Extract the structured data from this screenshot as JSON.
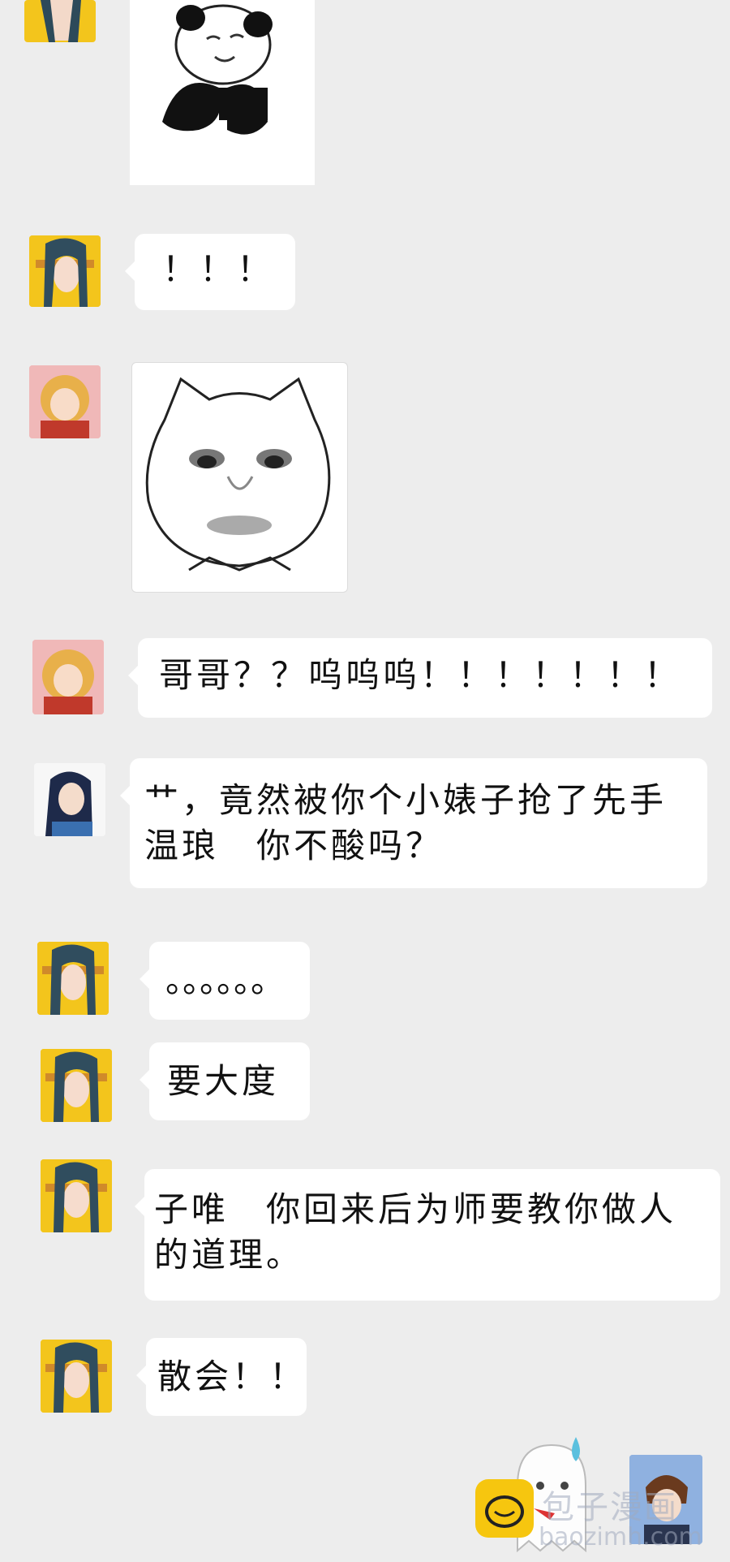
{
  "messages": [
    {
      "id": "m2",
      "text": "！！！"
    },
    {
      "id": "m4",
      "text": "哥哥？？呜呜呜！！！！！！！"
    },
    {
      "id": "m5",
      "line1": "艹，竟然被你个小婊子抢了先手",
      "line2": "温琅　你不酸吗？"
    },
    {
      "id": "m6",
      "text": "。。。。。。"
    },
    {
      "id": "m7",
      "text": "要大度"
    },
    {
      "id": "m8",
      "line1": "子唯　你回来后为师要教你做人",
      "line2": "的道理。"
    },
    {
      "id": "m9",
      "text": "散会！！"
    }
  ],
  "watermark": {
    "brand": "包子漫画",
    "url": "baozimh.com"
  },
  "colors": {
    "background": "#ededed",
    "bubble": "#ffffff",
    "avatar_yellow": "#f3c51c",
    "avatar_pink": "#f0b8b8"
  },
  "icons": [
    "panda-sticker",
    "cat-face-sticker",
    "ghost-mascot-icon",
    "bun-logo-icon"
  ]
}
